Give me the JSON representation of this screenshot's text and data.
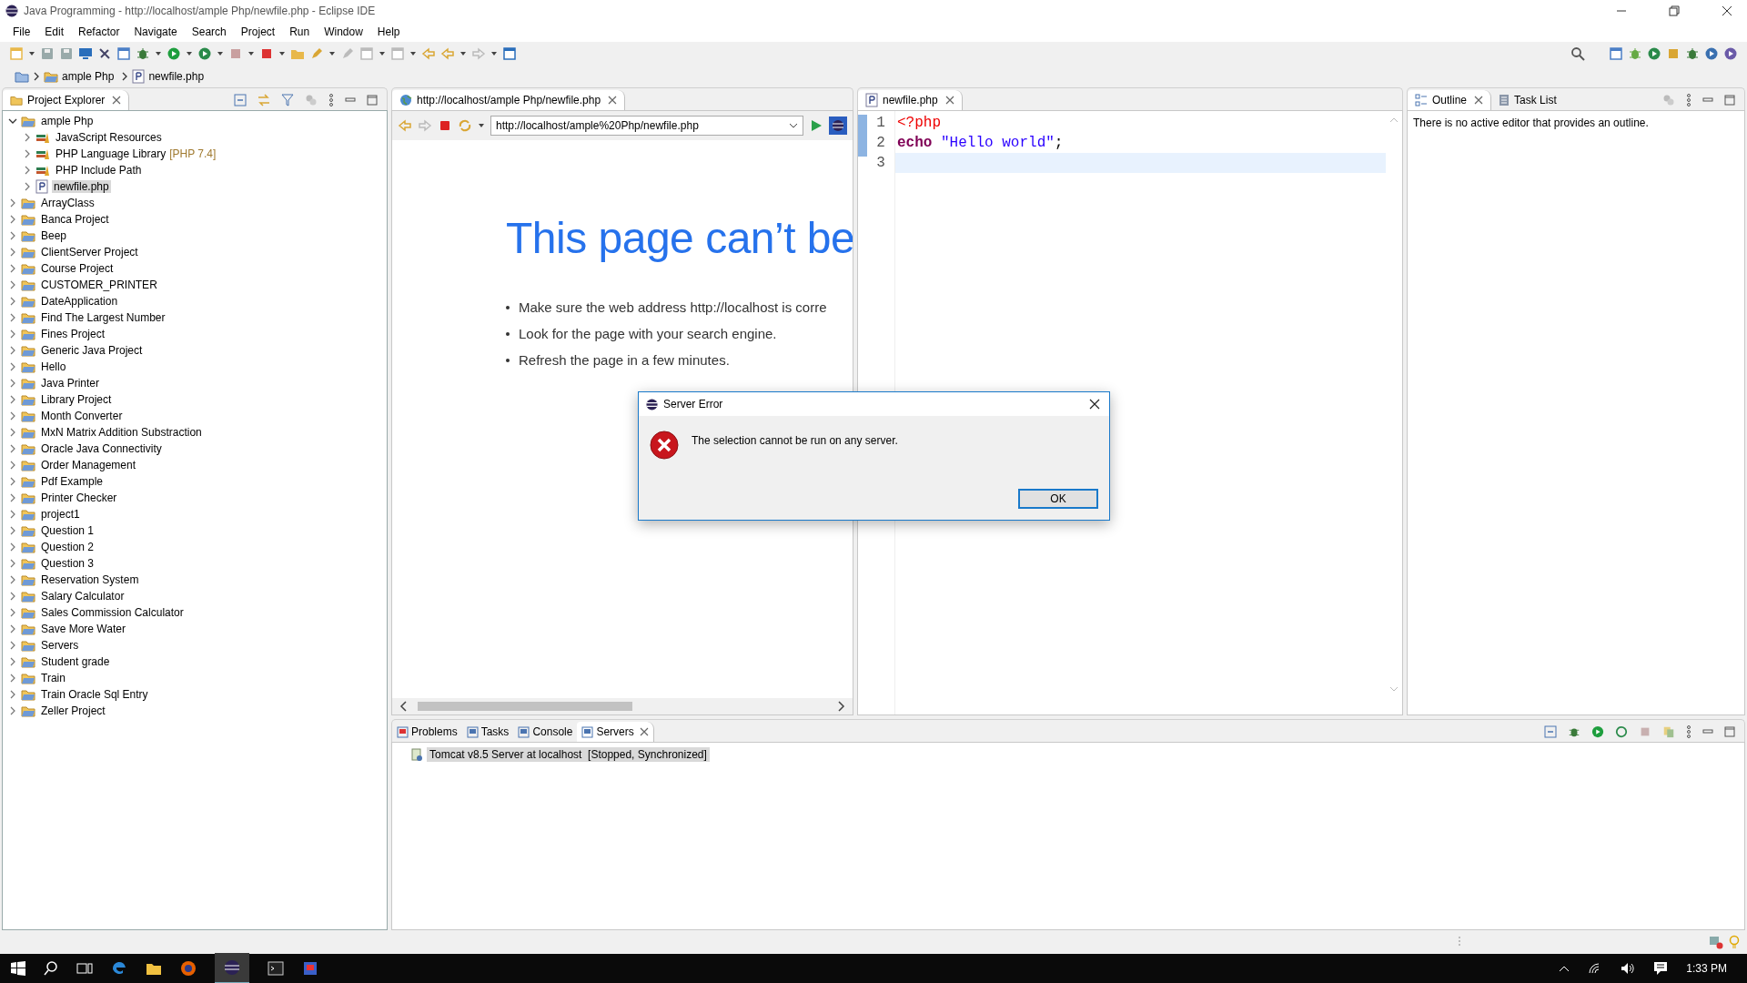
{
  "window": {
    "title": "Java Programming - http://localhost/ample Php/newfile.php - Eclipse IDE"
  },
  "menu": [
    "File",
    "Edit",
    "Refactor",
    "Navigate",
    "Search",
    "Project",
    "Run",
    "Window",
    "Help"
  ],
  "breadcrumb": [
    {
      "label": "ample Php",
      "kind": "project"
    },
    {
      "label": "newfile.php",
      "kind": "file"
    }
  ],
  "project_explorer": {
    "title": "Project Explorer",
    "tree": [
      {
        "label": "ample Php",
        "kind": "project",
        "expanded": true,
        "selected": false,
        "children": [
          {
            "label": "JavaScript Resources",
            "kind": "library",
            "expanded": false,
            "selected": false
          },
          {
            "label": "PHP Language Library",
            "suffix": "[PHP 7.4]",
            "kind": "library",
            "expanded": false,
            "selected": false
          },
          {
            "label": "PHP Include Path",
            "kind": "library",
            "expanded": false,
            "selected": false
          },
          {
            "label": "newfile.php",
            "kind": "file",
            "expanded": false,
            "selected": true
          }
        ]
      },
      {
        "label": "ArrayClass",
        "kind": "project",
        "expanded": false,
        "selected": false
      },
      {
        "label": "Banca Project",
        "kind": "project",
        "expanded": false,
        "selected": false
      },
      {
        "label": "Beep",
        "kind": "project",
        "expanded": false,
        "selected": false
      },
      {
        "label": "ClientServer Project",
        "kind": "project",
        "expanded": false,
        "selected": false
      },
      {
        "label": "Course Project",
        "kind": "project",
        "expanded": false,
        "selected": false
      },
      {
        "label": "CUSTOMER_PRINTER",
        "kind": "project",
        "expanded": false,
        "selected": false
      },
      {
        "label": "DateApplication",
        "kind": "project",
        "expanded": false,
        "selected": false
      },
      {
        "label": "Find The Largest Number",
        "kind": "project",
        "expanded": false,
        "selected": false
      },
      {
        "label": "Fines Project",
        "kind": "project",
        "expanded": false,
        "selected": false
      },
      {
        "label": "Generic Java Project",
        "kind": "project",
        "expanded": false,
        "selected": false
      },
      {
        "label": "Hello",
        "kind": "project",
        "expanded": false,
        "selected": false
      },
      {
        "label": "Java Printer",
        "kind": "project",
        "expanded": false,
        "selected": false
      },
      {
        "label": "Library Project",
        "kind": "project",
        "expanded": false,
        "selected": false
      },
      {
        "label": "Month Converter",
        "kind": "project",
        "expanded": false,
        "selected": false
      },
      {
        "label": "MxN Matrix Addition Substraction",
        "kind": "project",
        "expanded": false,
        "selected": false
      },
      {
        "label": "Oracle Java Connectivity",
        "kind": "project",
        "expanded": false,
        "selected": false
      },
      {
        "label": "Order Management",
        "kind": "project",
        "expanded": false,
        "selected": false
      },
      {
        "label": "Pdf Example",
        "kind": "project",
        "expanded": false,
        "selected": false
      },
      {
        "label": "Printer Checker",
        "kind": "project",
        "expanded": false,
        "selected": false
      },
      {
        "label": "project1",
        "kind": "project",
        "expanded": false,
        "selected": false
      },
      {
        "label": "Question 1",
        "kind": "project",
        "expanded": false,
        "selected": false
      },
      {
        "label": "Question 2",
        "kind": "project",
        "expanded": false,
        "selected": false
      },
      {
        "label": "Question 3",
        "kind": "project",
        "expanded": false,
        "selected": false
      },
      {
        "label": "Reservation System",
        "kind": "project",
        "expanded": false,
        "selected": false
      },
      {
        "label": "Salary Calculator",
        "kind": "project",
        "expanded": false,
        "selected": false
      },
      {
        "label": "Sales Commission Calculator",
        "kind": "project",
        "expanded": false,
        "selected": false
      },
      {
        "label": "Save More Water",
        "kind": "project",
        "expanded": false,
        "selected": false
      },
      {
        "label": "Servers",
        "kind": "project",
        "expanded": false,
        "selected": false
      },
      {
        "label": "Student grade",
        "kind": "project",
        "expanded": false,
        "selected": false
      },
      {
        "label": "Train",
        "kind": "project",
        "expanded": false,
        "selected": false
      },
      {
        "label": "Train Oracle Sql Entry",
        "kind": "project",
        "expanded": false,
        "selected": false
      },
      {
        "label": "Zeller Project",
        "kind": "project",
        "expanded": false,
        "selected": false
      }
    ]
  },
  "browser": {
    "tab": "http://localhost/ample Php/newfile.php",
    "url": "http://localhost/ample%20Php/newfile.php",
    "heading": "This page can’t be",
    "bullets": [
      "Make sure the web address http://localhost is corre",
      "Look for the page with your search engine.",
      "Refresh the page in a few minutes."
    ]
  },
  "editor": {
    "tab": "newfile.php",
    "lines": [
      {
        "number": "1",
        "current": false,
        "tokens": [
          {
            "text": "<?php",
            "kind": "tag"
          }
        ]
      },
      {
        "number": "2",
        "current": false,
        "tokens": [
          {
            "text": "echo",
            "kind": "keyword"
          },
          {
            "text": " \"Hello world\"",
            "kind": "string"
          },
          {
            "text": ";",
            "kind": "plain"
          }
        ]
      },
      {
        "number": "3",
        "current": true
      }
    ]
  },
  "outline": {
    "tabs": [
      {
        "label": "Outline",
        "selected": true
      },
      {
        "label": "Task List",
        "selected": false
      }
    ],
    "message": "There is no active editor that provides an outline."
  },
  "bottom_panel": {
    "tabs": [
      {
        "label": "Problems",
        "selected": false
      },
      {
        "label": "Tasks",
        "selected": false
      },
      {
        "label": "Console",
        "selected": false
      },
      {
        "label": "Servers",
        "selected": true
      }
    ],
    "servers": [
      {
        "name": "Tomcat v8.5 Server at localhost",
        "status": "[Stopped, Synchronized]",
        "selected": true
      }
    ]
  },
  "dialog": {
    "title": "Server Error",
    "message": "The selection cannot be run on any server.",
    "button": "OK"
  },
  "taskbar": {
    "clock": "1:33 PM"
  }
}
